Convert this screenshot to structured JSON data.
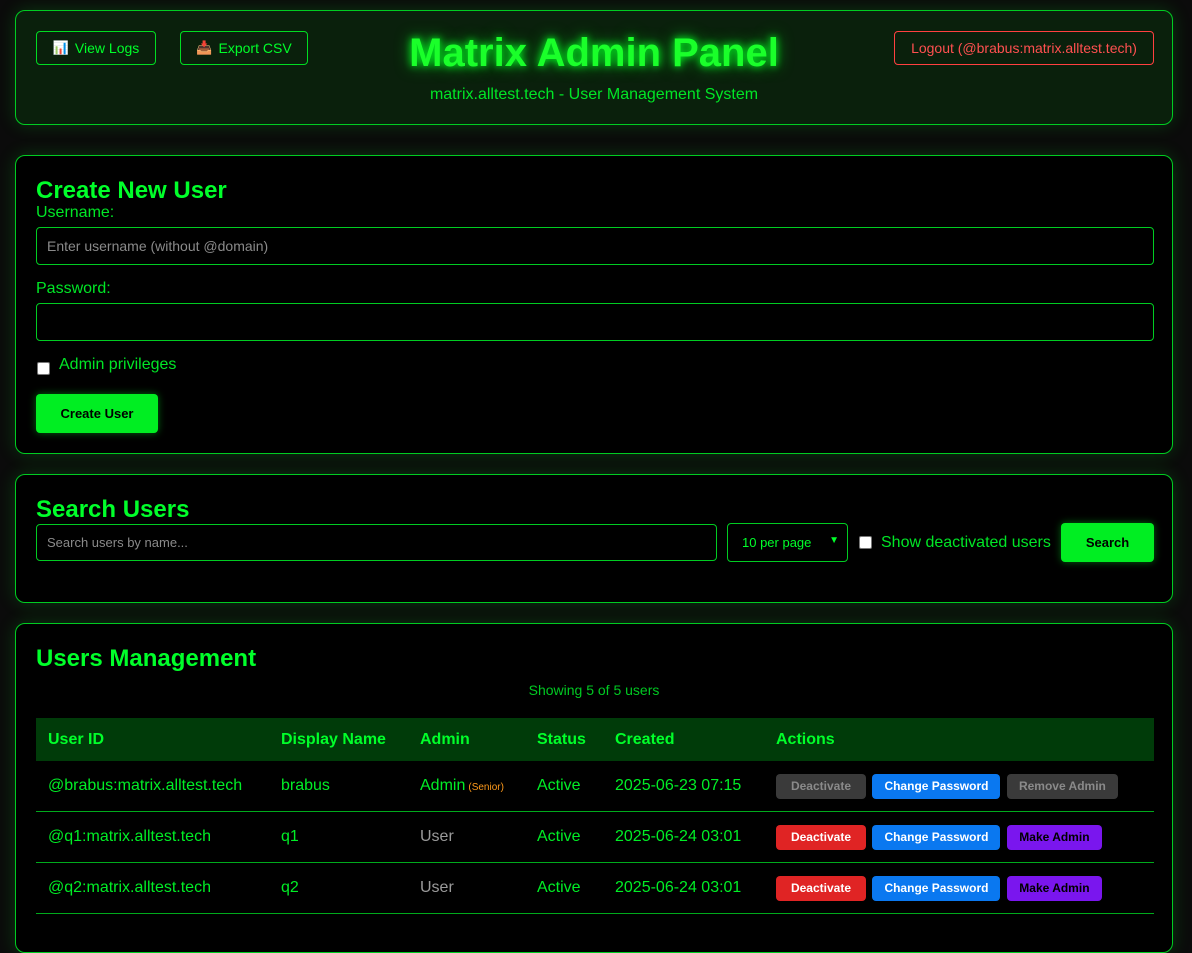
{
  "header": {
    "title": "Matrix Admin Panel",
    "subtitle": "matrix.alltest.tech - User Management System",
    "view_logs_icon": "📊",
    "view_logs": "View Logs",
    "export_icon": "📥",
    "export_csv": "Export CSV",
    "logout": "Logout (@brabus:matrix.alltest.tech)"
  },
  "create_user": {
    "heading": "Create New User",
    "username_label": "Username:",
    "username_placeholder": "Enter username (without @domain)",
    "password_label": "Password:",
    "password_value": "",
    "admin_label": "Admin privileges",
    "admin_checked": false,
    "submit": "Create User"
  },
  "search": {
    "heading": "Search Users",
    "placeholder": "Search users by name...",
    "per_page": "10 per page",
    "show_deactivated_label": "Show deactivated users",
    "show_deactivated_checked": false,
    "button": "Search"
  },
  "users": {
    "heading": "Users Management",
    "showing": "Showing 5 of 5 users",
    "columns": {
      "user_id": "User ID",
      "display_name": "Display Name",
      "admin": "Admin",
      "status": "Status",
      "created": "Created",
      "actions": "Actions"
    },
    "rows": [
      {
        "user_id": "@brabus:matrix.alltest.tech",
        "display_name": "brabus",
        "admin": "Admin",
        "admin_note": "(Senior)",
        "status": "Active",
        "created": "2025-06-23 07:15",
        "deactivate": "Deactivate",
        "change_password": "Change Password",
        "admin_action": "Remove Admin"
      },
      {
        "user_id": "@q1:matrix.alltest.tech",
        "display_name": "q1",
        "admin": "User",
        "status": "Active",
        "created": "2025-06-24 03:01",
        "deactivate": "Deactivate",
        "change_password": "Change Password",
        "admin_action": "Make Admin"
      },
      {
        "user_id": "@q2:matrix.alltest.tech",
        "display_name": "q2",
        "admin": "User",
        "status": "Active",
        "created": "2025-06-24 03:01",
        "deactivate": "Deactivate",
        "change_password": "Change Password",
        "admin_action": "Make Admin"
      }
    ]
  },
  "colors": {
    "accent": "#00ff2a",
    "danger": "#e02424",
    "info": "#0a78f0",
    "admin": "#7a16ee",
    "senior": "#ff9a1a"
  }
}
